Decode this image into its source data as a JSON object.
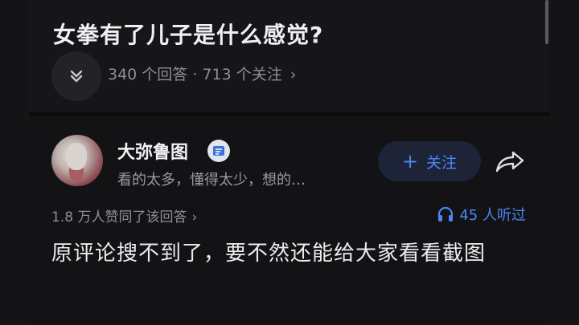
{
  "question": {
    "title": "女拳有了儿子是什么感觉?",
    "meta": "340 个回答 · 713 个关注",
    "meta_chevron": "›"
  },
  "answer": {
    "author": {
      "name": "大弥鲁图",
      "bio": "看的太多，懂得太少，想的…"
    },
    "follow_label": "关注",
    "follow_plus": "+",
    "upvote_text": "1.8 万人赞同了该回答",
    "upvote_chevron": "›",
    "listeners_text": "45 人听过",
    "body": "原评论搜不到了，要不然还能给大家看看截图"
  },
  "colors": {
    "accent": "#4c86f5",
    "background": "#0d0d0f"
  },
  "icons": [
    "chevron-double-down-icon",
    "badge-icon",
    "share-icon",
    "headphones-icon"
  ]
}
